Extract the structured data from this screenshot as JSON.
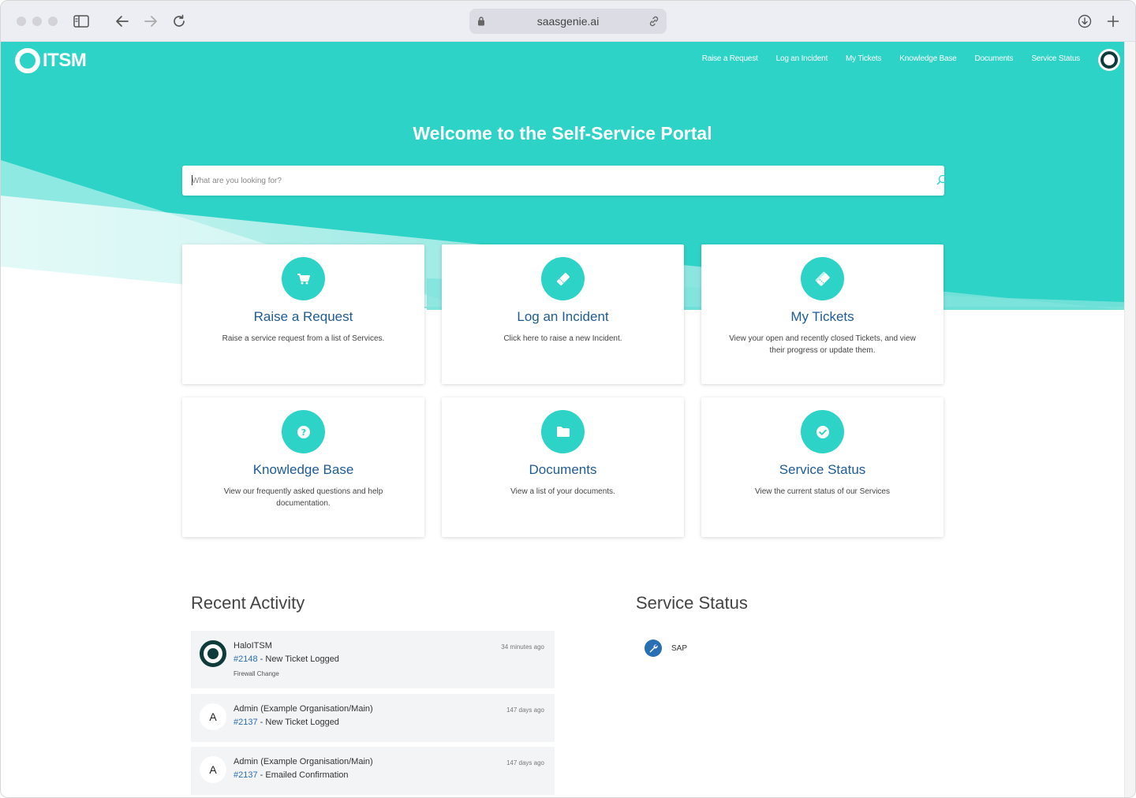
{
  "browser": {
    "url": "saasgenie.ai"
  },
  "brand": {
    "logo_text": "ITSM",
    "accent": "#2dd3c6",
    "link": "#1f5b94"
  },
  "nav": {
    "items": [
      "Raise a Request",
      "Log an Incident",
      "My Tickets",
      "Knowledge Base",
      "Documents",
      "Service Status"
    ]
  },
  "hero": {
    "title": "Welcome to the Self-Service Portal",
    "search_placeholder": "What are you looking for?"
  },
  "cards": [
    {
      "title": "Raise a Request",
      "desc": "Raise a service request from a list of Services.",
      "icon": "cart-icon"
    },
    {
      "title": "Log an Incident",
      "desc": "Click here to raise a new Incident.",
      "icon": "ticket-icon"
    },
    {
      "title": "My Tickets",
      "desc": "View your open and recently closed Tickets, and view their progress or update them.",
      "icon": "tickets-icon"
    },
    {
      "title": "Knowledge Base",
      "desc": "View our frequently asked questions and help documentation.",
      "icon": "question-icon"
    },
    {
      "title": "Documents",
      "desc": "View a list of your documents.",
      "icon": "folder-icon"
    },
    {
      "title": "Service Status",
      "desc": "View the current status of our Services",
      "icon": "check-icon"
    }
  ],
  "recent_activity": {
    "title": "Recent Activity",
    "items": [
      {
        "user": "HaloITSM",
        "ticket": "#2148",
        "text": " - New Ticket Logged",
        "sub": "Firewall Change",
        "time": "34 minutes ago",
        "avatar": ""
      },
      {
        "user": "Admin (Example Organisation/Main)",
        "ticket": "#2137",
        "text": " - New Ticket Logged",
        "sub": "",
        "time": "147 days ago",
        "avatar": "A"
      },
      {
        "user": "Admin (Example Organisation/Main)",
        "ticket": "#2137",
        "text": " - Emailed Confirmation",
        "sub": "",
        "time": "147 days ago",
        "avatar": "A"
      }
    ]
  },
  "service_status": {
    "title": "Service Status",
    "items": [
      {
        "name": "SAP",
        "icon": "wrench-icon"
      }
    ]
  }
}
